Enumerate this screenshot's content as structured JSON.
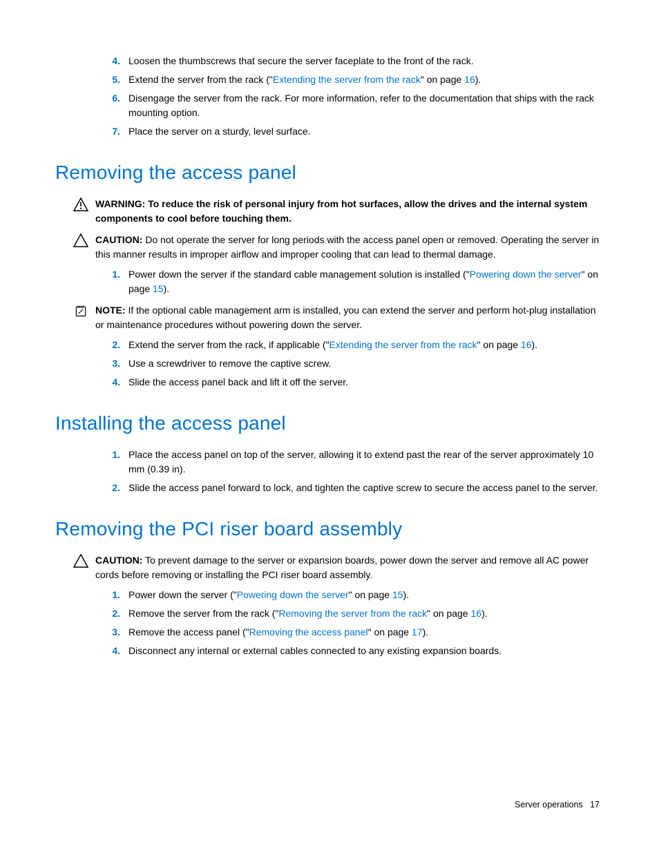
{
  "top_list": {
    "items": [
      {
        "num": "4.",
        "text": "Loosen the thumbscrews that secure the server faceplate to the front of the rack."
      },
      {
        "num": "5.",
        "pre": "Extend the server from the rack (\"",
        "link": "Extending the server from the rack",
        "mid": "\" on page ",
        "page": "16",
        "post": ")."
      },
      {
        "num": "6.",
        "text": "Disengage the server from the rack. For more information, refer to the documentation that ships with the rack mounting option."
      },
      {
        "num": "7.",
        "text": "Place the server on a sturdy, level surface."
      }
    ]
  },
  "section1": {
    "heading": "Removing the access panel",
    "warning": {
      "label": "WARNING:",
      "text": "  To reduce the risk of personal injury from hot surfaces, allow the drives and the internal system components to cool before touching them."
    },
    "caution": {
      "label": "CAUTION:",
      "text": "  Do not operate the server for long periods with the access panel open or removed. Operating the server in this manner results in improper airflow and improper cooling that can lead to thermal damage."
    },
    "step1": {
      "num": "1.",
      "pre": "Power down the server if the standard cable management solution is installed (\"",
      "link": "Powering down the server",
      "mid": "\" on page ",
      "page": "15",
      "post": ")."
    },
    "note": {
      "label": "NOTE:",
      "text": "  If the optional cable management arm is installed, you can extend the server and perform hot-plug installation or maintenance procedures without powering down the server."
    },
    "step2": {
      "num": "2.",
      "pre": "Extend the server from the rack, if applicable (\"",
      "link": "Extending the server from the rack",
      "mid": "\" on page ",
      "page": "16",
      "post": ")."
    },
    "step3": {
      "num": "3.",
      "text": "Use a screwdriver to remove the captive screw."
    },
    "step4": {
      "num": "4.",
      "text": "Slide the access panel back and lift it off the server."
    }
  },
  "section2": {
    "heading": "Installing the access panel",
    "step1": {
      "num": "1.",
      "text": "Place the access panel on top of the server, allowing it to extend past the rear of the server approximately 10 mm (0.39 in)."
    },
    "step2": {
      "num": "2.",
      "text": "Slide the access panel forward to lock, and tighten the captive screw to secure the access panel to the server."
    }
  },
  "section3": {
    "heading": "Removing the PCI riser board assembly",
    "caution": {
      "label": "CAUTION:",
      "text": "  To prevent damage to the server or expansion boards, power down the server and remove all AC power cords before removing or installing the PCI riser board assembly."
    },
    "step1": {
      "num": "1.",
      "pre": "Power down the server (\"",
      "link": "Powering down the server",
      "mid": "\" on page ",
      "page": "15",
      "post": ")."
    },
    "step2": {
      "num": "2.",
      "pre": "Remove the server from the rack (\"",
      "link": "Removing the server from the rack",
      "mid": "\" on page ",
      "page": "16",
      "post": ")."
    },
    "step3": {
      "num": "3.",
      "pre": "Remove the access panel (\"",
      "link": "Removing the access panel",
      "mid": "\" on page ",
      "page": "17",
      "post": ")."
    },
    "step4": {
      "num": "4.",
      "text": "Disconnect any internal or external cables connected to any existing expansion boards."
    }
  },
  "footer": {
    "section": "Server operations",
    "page": "17"
  }
}
